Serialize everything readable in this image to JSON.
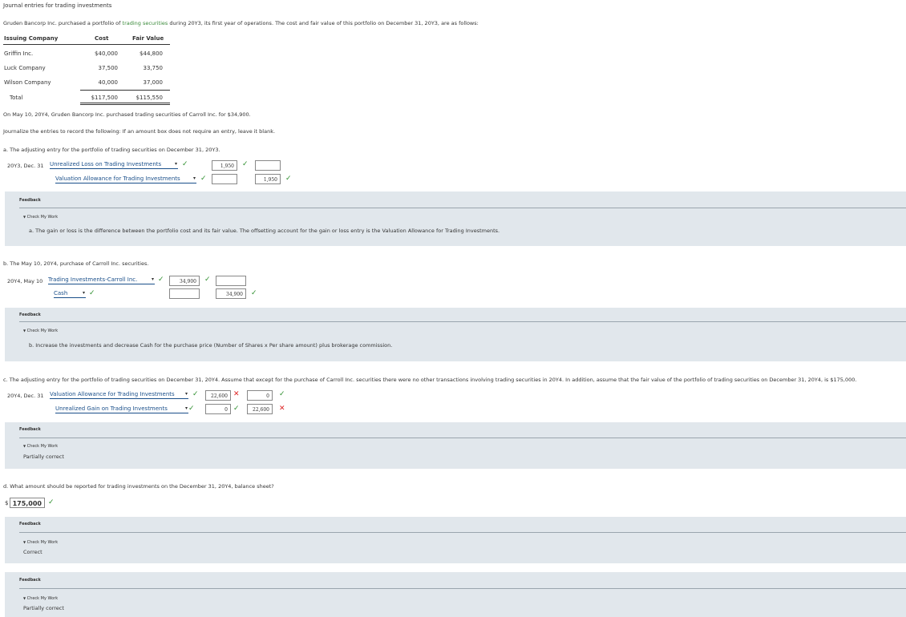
{
  "title": "Journal entries for trading investments",
  "intro": {
    "part1": "Gruden Bancorp Inc. purchased a portfolio of ",
    "link": "trading securities",
    "part2": " during 20Y3, its first year of operations. The cost and fair value of this portfolio on December 31, 20Y3, are as follows:"
  },
  "table": {
    "headers": [
      "Issuing Company",
      "Cost",
      "Fair Value"
    ],
    "rows": [
      {
        "company": "Griffin Inc.",
        "cost": "$40,000",
        "fair": "$44,800"
      },
      {
        "company": "Luck Company",
        "cost": "37,500",
        "fair": "33,750"
      },
      {
        "company": "Wilson Company",
        "cost": "40,000",
        "fair": "37,000"
      }
    ],
    "total": {
      "label": "Total",
      "cost": "$117,500",
      "fair": "$115,550"
    }
  },
  "purchase_note": "On May 10, 20Y4, Gruden Bancorp Inc. purchased trading securities of Carroll Inc. for $34,900.",
  "instruction": "Journalize the entries to record the following: If an amount box does not require an entry, leave it blank.",
  "parts": {
    "a": {
      "prompt": "a.  The adjusting entry for the portfolio of trading securities on December 31, 20Y3.",
      "date": "20Y3, Dec. 31",
      "debit_account": "Unrealized Loss on Trading Investments",
      "debit_amount": "1,950",
      "credit_account": "Valuation Allowance for Trading Investments",
      "credit_amount": "1,950",
      "feedback_label": "Feedback",
      "check_label": "Check My Work",
      "feedback_text": "a.  The gain or loss is the difference between the portfolio cost and its fair value. The offsetting account for the gain or loss entry is the Valuation Allowance for Trading Investments."
    },
    "b": {
      "prompt": "b.  The May 10, 20Y4, purchase of Carroll Inc. securities.",
      "date": "20Y4, May 10",
      "debit_account": "Trading Investments-Carroll Inc.",
      "debit_amount": "34,900",
      "credit_account": "Cash",
      "credit_amount": "34,900",
      "feedback_label": "Feedback",
      "check_label": "Check My Work",
      "feedback_text": "b.  Increase the investments and decrease Cash for the purchase price (Number of Shares x Per share amount) plus brokerage commission."
    },
    "c": {
      "prompt": "c.  The adjusting entry for the portfolio of trading securities on December 31, 20Y4. Assume that except for the purchase of Carroll Inc. securities there were no other transactions involving trading securities in 20Y4. In addition, assume that the fair value of the portfolio of trading securities on December 31, 20Y4, is $175,000.",
      "date": "20Y4, Dec. 31",
      "row1_account": "Valuation Allowance for Trading Investments",
      "row1_debit": "22,600",
      "row1_credit": "0",
      "row2_account": "Unrealized Gain on Trading Investments",
      "row2_debit": "0",
      "row2_credit": "22,600",
      "feedback_label": "Feedback",
      "check_label": "Check My Work",
      "feedback_text": "Partially correct"
    },
    "d": {
      "prompt": "d.  What amount should be reported for trading investments on the December 31, 20Y4, balance sheet?",
      "currency": "$",
      "amount": "175,000",
      "feedback_label": "Feedback",
      "check_label": "Check My Work",
      "feedback_text": "Correct"
    }
  },
  "final_feedback": {
    "label": "Feedback",
    "check_label": "Check My Work",
    "text": "Partially correct"
  },
  "glyphs": {
    "check": "✓",
    "cross": "✕",
    "caret": "▾",
    "triangle": "▼"
  },
  "colors": {
    "feedback_bg": "#e1e7ec",
    "link": "#1a4f8a",
    "correct": "#2f8f2f",
    "wrong": "#dd2222"
  }
}
